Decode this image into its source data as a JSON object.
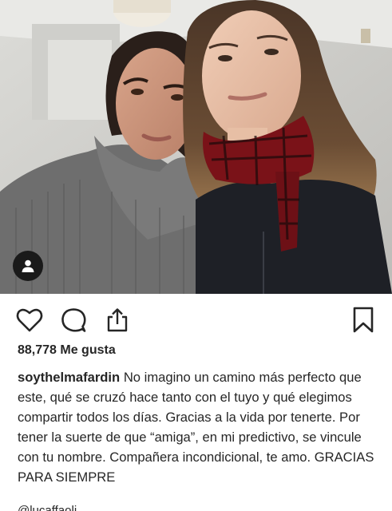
{
  "post": {
    "likes_text": "88,778 Me gusta",
    "username": "soythelmafardin",
    "caption": "No imagino un camino más perfecto que este, qué se cruzó hace tanto con el tuyo y qué elegimos compartir todos los días. Gracias a la vida por tenerte. Por tener la suerte de que “amiga”, en mi predictivo, se vincule con tu nombre. Compañera incondicional, te amo. GRACIAS PARA SIEMPRE",
    "next_line_partial": "@lucaffaoli..."
  },
  "icons": {
    "like": "heart-outline-icon",
    "comment": "speech-bubble-icon",
    "share": "share-upload-icon",
    "save": "bookmark-outline-icon",
    "user_tag": "person-icon"
  },
  "colors": {
    "text": "#262626",
    "icon": "#262626",
    "tag_bg": "#1a1a1a"
  }
}
